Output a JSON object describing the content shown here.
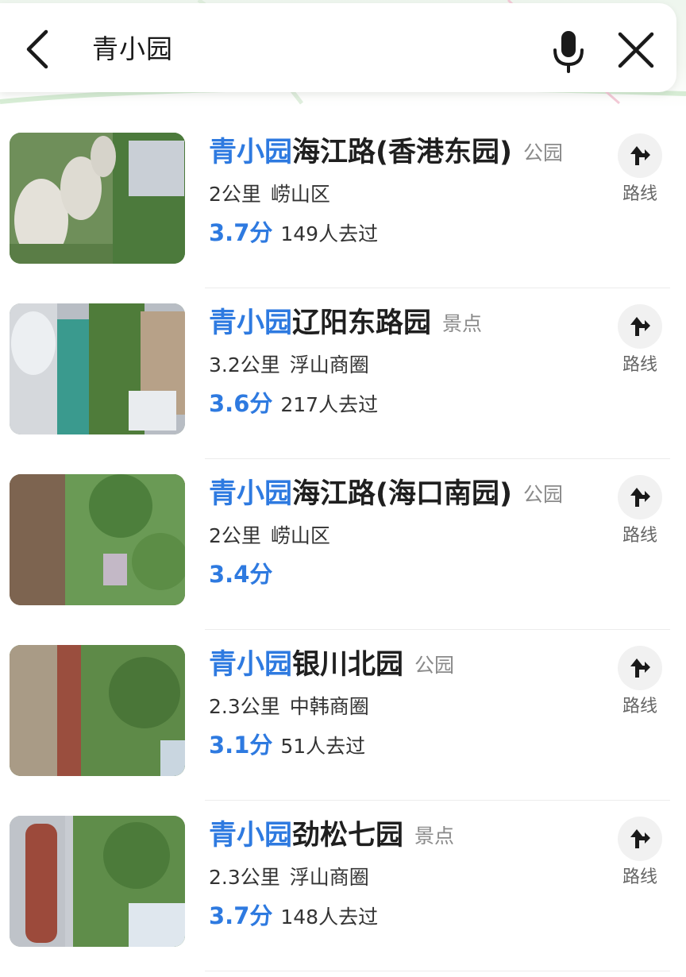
{
  "search": {
    "query": "青小园"
  },
  "route_label": "路线",
  "colors": {
    "accent": "#2e7ae0",
    "category": "#8a8a8a",
    "text": "#1f1f1f"
  },
  "results": [
    {
      "highlight": "青小园",
      "name": "海江路(香港东园)",
      "category": "公园",
      "distance": "2公里",
      "area": "崂山区",
      "score": "3.7分",
      "visits": "149人去过",
      "thumb_icon": "park-photo-stepping-stones"
    },
    {
      "highlight": "青小园",
      "name": "辽阳东路园",
      "category": "景点",
      "distance": "3.2公里",
      "area": "浮山商圈",
      "score": "3.6分",
      "visits": "217人去过",
      "thumb_icon": "park-photo-playground"
    },
    {
      "highlight": "青小园",
      "name": "海江路(海口南园)",
      "category": "公园",
      "distance": "2公里",
      "area": "崂山区",
      "score": "3.4分",
      "visits": "",
      "thumb_icon": "park-photo-trees"
    },
    {
      "highlight": "青小园",
      "name": "银川北园",
      "category": "公园",
      "distance": "2.3公里",
      "area": "中韩商圈",
      "score": "3.1分",
      "visits": "51人去过",
      "thumb_icon": "park-photo-path"
    },
    {
      "highlight": "青小园",
      "name": "劲松七园",
      "category": "景点",
      "distance": "2.3公里",
      "area": "浮山商圈",
      "score": "3.7分",
      "visits": "148人去过",
      "thumb_icon": "park-photo-bench"
    }
  ]
}
